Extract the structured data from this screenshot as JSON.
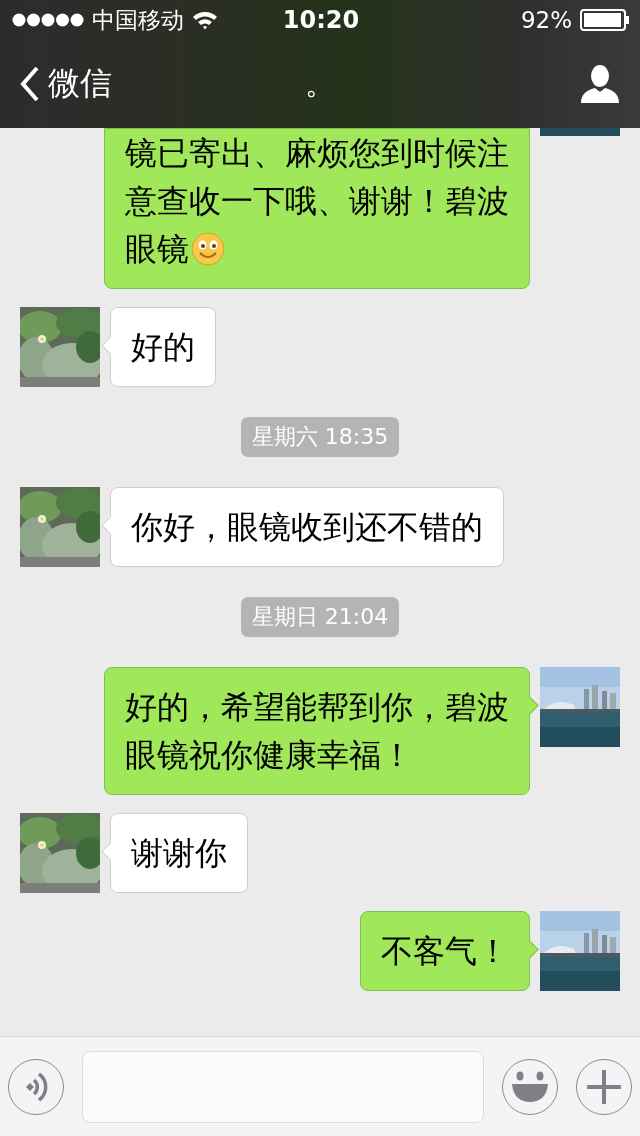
{
  "status_bar": {
    "carrier": "中国移动",
    "time": "10:20",
    "battery": "92%"
  },
  "nav": {
    "back": "微信",
    "title": "。"
  },
  "messages": [
    {
      "kind": "sent",
      "text": "镜已寄出、麻烦您到时候注意查收一下哦、谢谢！碧波眼镜",
      "emoji": true,
      "clipped": true
    },
    {
      "kind": "received",
      "text": "好的",
      "emoji": false,
      "clipped": false
    },
    {
      "kind": "time",
      "text": "星期六 18:35"
    },
    {
      "kind": "received",
      "text": "你好，眼镜收到还不错的",
      "emoji": false,
      "clipped": false
    },
    {
      "kind": "time",
      "text": "星期日 21:04"
    },
    {
      "kind": "sent",
      "text": "好的，希望能帮到你，碧波眼镜祝你健康幸福！",
      "emoji": false,
      "clipped": false
    },
    {
      "kind": "received",
      "text": "谢谢你",
      "emoji": false,
      "clipped": false
    },
    {
      "kind": "sent",
      "text": "不客气！",
      "emoji": false,
      "clipped": false
    }
  ]
}
